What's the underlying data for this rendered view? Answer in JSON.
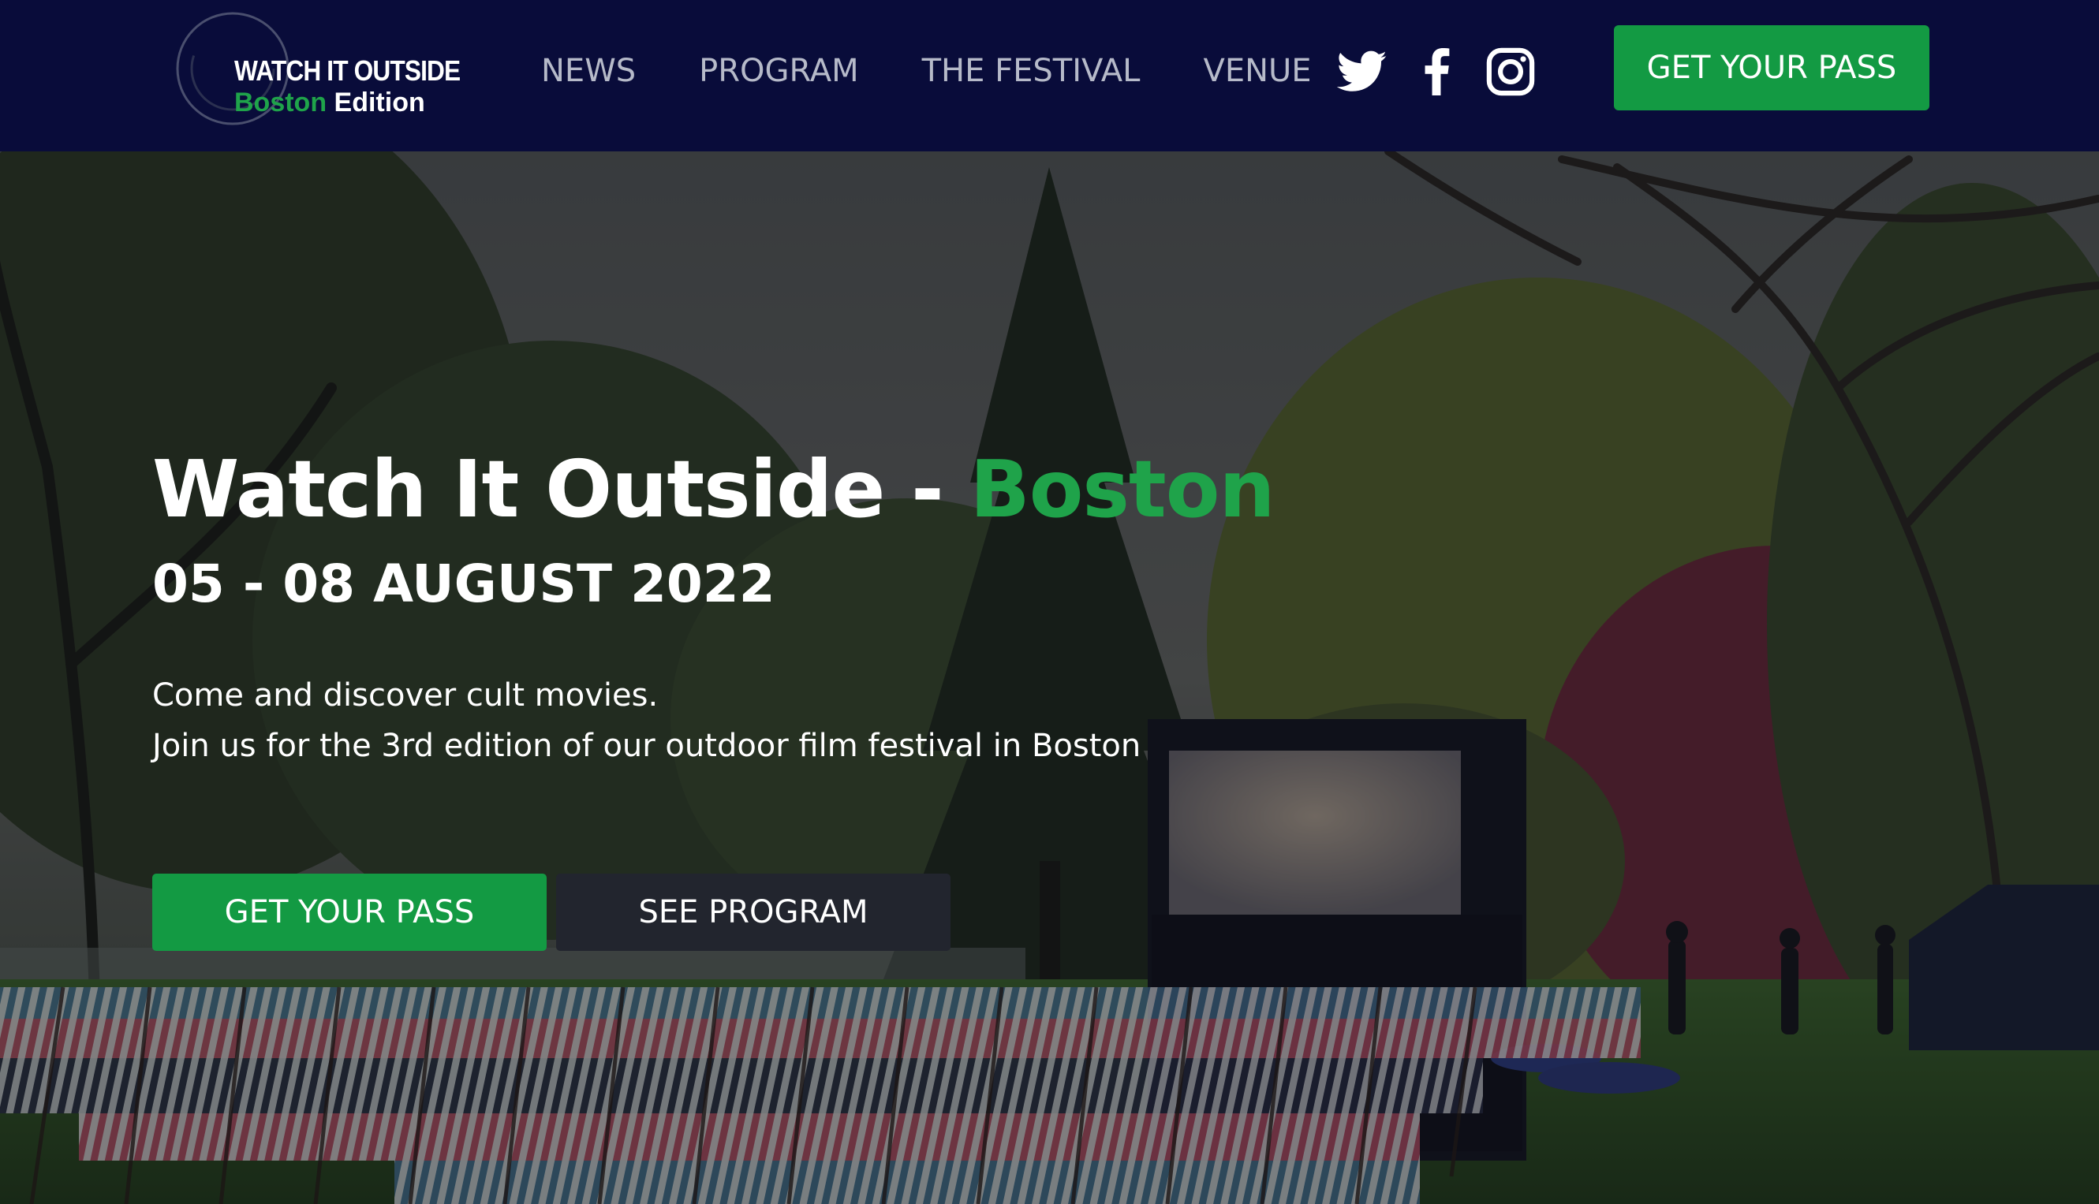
{
  "logo": {
    "line1": "WATCH IT OUTSIDE",
    "line2_accent": "Boston",
    "line2_rest": " Edition"
  },
  "nav": {
    "links": [
      {
        "label": "NEWS"
      },
      {
        "label": "PROGRAM"
      },
      {
        "label": "THE FESTIVAL"
      },
      {
        "label": "VENUE"
      }
    ],
    "socials": [
      {
        "icon": "twitter-icon"
      },
      {
        "icon": "facebook-icon"
      },
      {
        "icon": "instagram-icon"
      }
    ],
    "cta_label": "GET YOUR PASS"
  },
  "hero": {
    "title_main": "Watch It Outside - ",
    "title_accent": "Boston",
    "date": "05 - 08 AUGUST 2022",
    "description_line1": "Come and discover cult movies.",
    "description_line2": "Join us for the 3rd edition of our outdoor film festival in Boston",
    "primary_button": "GET YOUR PASS",
    "secondary_button": "SEE PROGRAM"
  },
  "colors": {
    "navbar_bg": "#090c3a",
    "accent_green": "#139a43",
    "dark_button": "#22252e",
    "nav_text": "#b6bac9"
  }
}
